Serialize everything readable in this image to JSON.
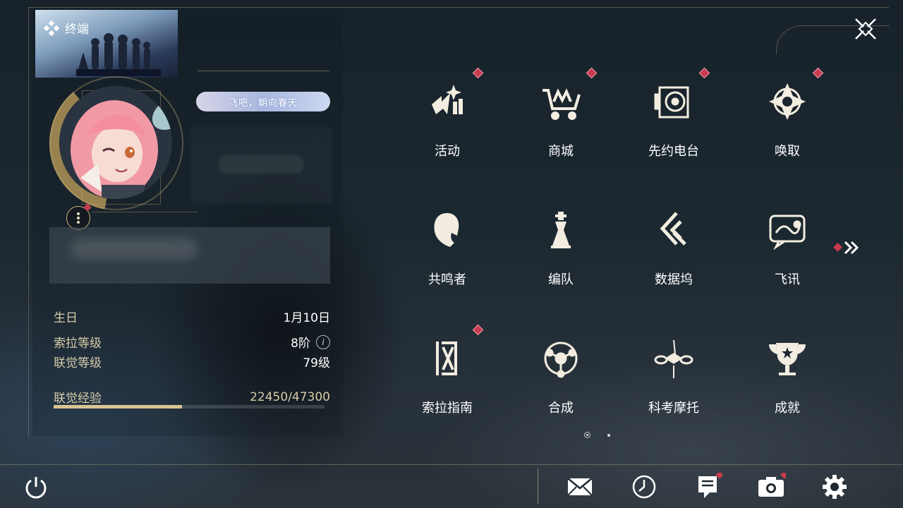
{
  "header": {
    "title": "终端"
  },
  "profile": {
    "signature": "飞吧，朝向春天",
    "birthday_label": "生日",
    "birthday_value": "1月10日",
    "sola_level_label": "索拉等级",
    "sola_level_value": "8阶",
    "info_icon": "i",
    "union_level_label": "联觉等级",
    "union_level_value": "79级",
    "union_exp_label": "联觉经验",
    "union_exp_value": "22450/47300",
    "union_exp_fraction": 0.4746
  },
  "menu": [
    {
      "label": "活动",
      "icon": "event-icon",
      "badge": true
    },
    {
      "label": "商城",
      "icon": "shop-icon",
      "badge": true
    },
    {
      "label": "先约电台",
      "icon": "radio-icon",
      "badge": true
    },
    {
      "label": "唤取",
      "icon": "convene-icon",
      "badge": true
    },
    {
      "label": "共鸣者",
      "icon": "resonator-icon",
      "badge": false
    },
    {
      "label": "编队",
      "icon": "team-icon",
      "badge": false
    },
    {
      "label": "数据坞",
      "icon": "data-bank-icon",
      "badge": false
    },
    {
      "label": "飞讯",
      "icon": "message-icon",
      "badge": false
    },
    {
      "label": "索拉指南",
      "icon": "guidebook-icon",
      "badge": true
    },
    {
      "label": "合成",
      "icon": "synthesis-icon",
      "badge": false
    },
    {
      "label": "科考摩托",
      "icon": "motorcycle-icon",
      "badge": false
    },
    {
      "label": "成就",
      "icon": "achievement-icon",
      "badge": false
    }
  ],
  "pager": {
    "current": 1,
    "total": 2
  },
  "bottom_bar": [
    "power-icon",
    "mail-icon",
    "clock-icon",
    "notice-icon",
    "camera-icon",
    "settings-icon"
  ],
  "colors": {
    "accent_gold": "#d9c493",
    "badge_red": "#c83c50",
    "text_white": "#ffffff",
    "label_gold": "#d6cca8"
  }
}
